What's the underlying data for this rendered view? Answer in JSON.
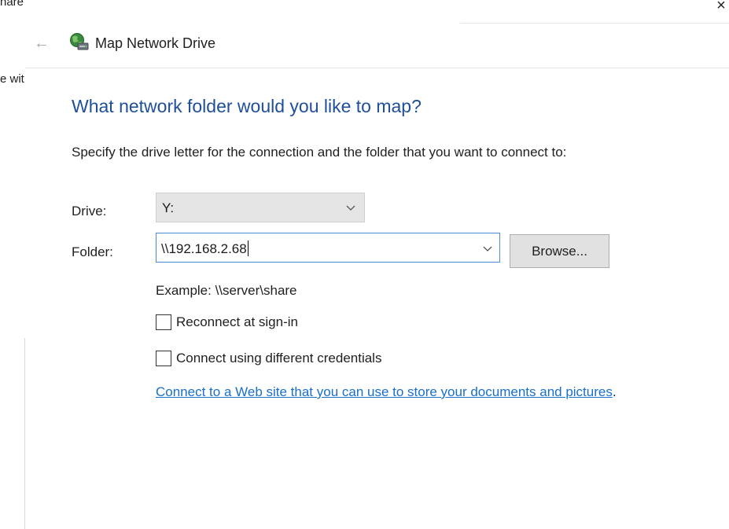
{
  "background": {
    "top_fragment": "nare",
    "mid_fragment": "e wit"
  },
  "window": {
    "close_glyph": "×"
  },
  "header": {
    "back_glyph": "←",
    "title": "Map Network Drive",
    "icon": "network-drive-icon"
  },
  "main": {
    "heading": "What network folder would you like to map?",
    "instructions": "Specify the drive letter for the connection and the folder that you want to connect to:",
    "drive": {
      "label": "Drive:",
      "selected": "Y:"
    },
    "folder": {
      "label": "Folder:",
      "value": "\\\\192.168.2.68"
    },
    "browse_label": "Browse...",
    "example": "Example: \\\\server\\share",
    "reconnect": {
      "label": "Reconnect at sign-in",
      "checked": false
    },
    "credentials": {
      "label": "Connect using different credentials",
      "checked": false
    },
    "link": {
      "text": "Connect to a Web site that you can use to store your documents and pictures",
      "trailing": "."
    }
  },
  "colors": {
    "heading": "#1f4e9a",
    "link": "#1a6fc9",
    "focus_border": "#4a8cd6"
  }
}
